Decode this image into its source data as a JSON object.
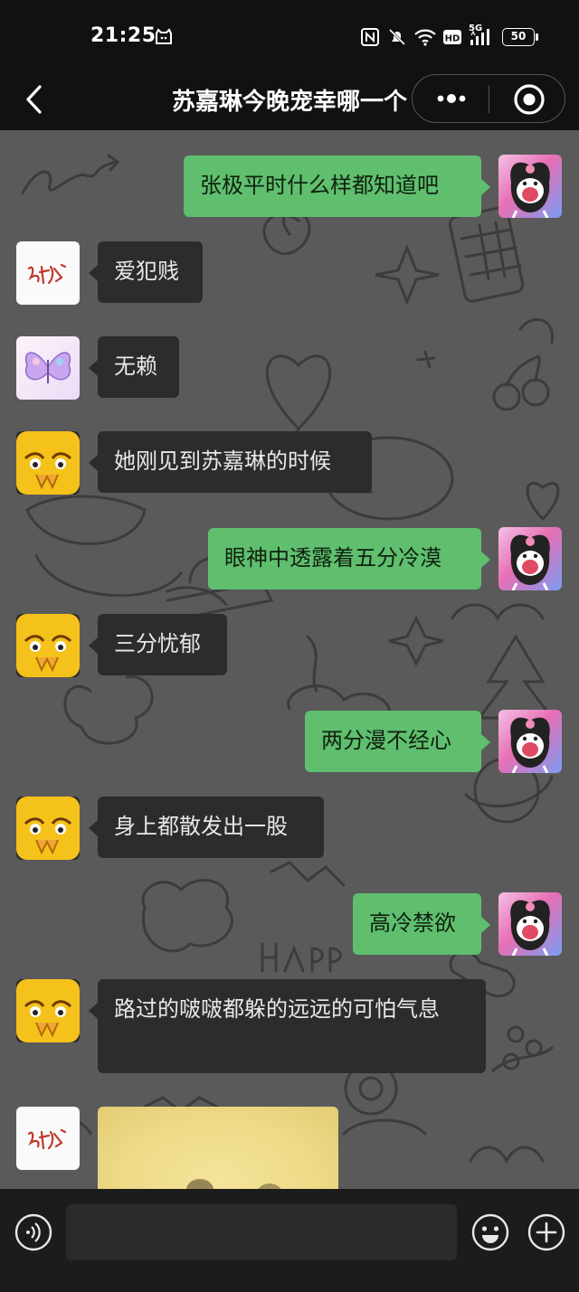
{
  "status_bar": {
    "time": "21:25",
    "network": "5G",
    "battery": "50",
    "icons": [
      "cat-notification-icon",
      "nfc-icon",
      "mute-icon",
      "wifi-icon",
      "hd-icon",
      "signal-icon",
      "battery-icon"
    ]
  },
  "nav": {
    "title": "苏嘉琳今晚宠幸哪一个",
    "icons": [
      "back-icon",
      "more-icon",
      "close-circle-icon"
    ]
  },
  "messages": [
    {
      "side": "right",
      "avatar": "kuromi-avatar",
      "text": "张极平时什么样都知道吧"
    },
    {
      "side": "left",
      "avatar": "signature-avatar",
      "text": "爱犯贱"
    },
    {
      "side": "left",
      "avatar": "butterfly-avatar",
      "text": "无赖"
    },
    {
      "side": "left",
      "avatar": "emoji-avatar",
      "text": "她刚见到苏嘉琳的时候"
    },
    {
      "side": "right",
      "avatar": "kuromi-avatar",
      "text": "眼神中透露着五分冷漠"
    },
    {
      "side": "left",
      "avatar": "emoji-avatar",
      "text": "三分忧郁"
    },
    {
      "side": "right",
      "avatar": "kuromi-avatar",
      "text": "两分漫不经心"
    },
    {
      "side": "left",
      "avatar": "emoji-avatar",
      "text": "身上都散发出一股"
    },
    {
      "side": "right",
      "avatar": "kuromi-avatar",
      "text": "高冷禁欲"
    },
    {
      "side": "left",
      "avatar": "emoji-avatar",
      "text": "路过的啵啵都躲的远远的可怕气息"
    },
    {
      "side": "left",
      "avatar": "signature-avatar",
      "text": "",
      "image": "photo-message"
    }
  ],
  "input_bar": {
    "icons": [
      "voice-icon",
      "emoji-icon",
      "plus-icon"
    ],
    "value": ""
  },
  "colors": {
    "right_bubble": "#5fbf6f",
    "left_bubble": "#2c2c2c",
    "chat_background": "#5a5a5a",
    "bars": "#111111"
  }
}
